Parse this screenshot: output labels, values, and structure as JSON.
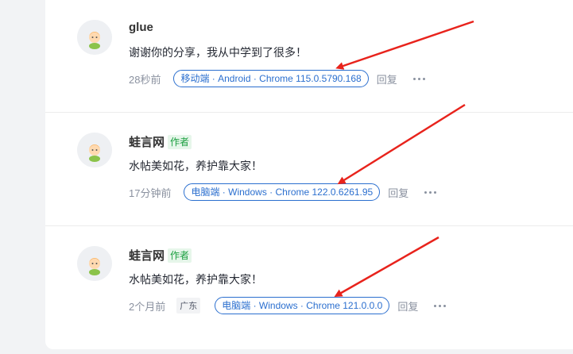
{
  "comments": [
    {
      "username": "glue",
      "author_tag": "",
      "content": "谢谢你的分享，我从中学到了很多！",
      "time": "28秒前",
      "location": "",
      "device": "移动端 · Android · Chrome 115.0.5790.168",
      "reply_label": "回复"
    },
    {
      "username": "蛙言网",
      "author_tag": "作者",
      "content": "水帖美如花，养护靠大家！",
      "time": "17分钟前",
      "location": "",
      "device": "电脑端 · Windows · Chrome 122.0.6261.95",
      "reply_label": "回复"
    },
    {
      "username": "蛙言网",
      "author_tag": "作者",
      "content": "水帖美如花，养护靠大家！",
      "time": "2个月前",
      "location": "广东",
      "device": "电脑端 · Windows · Chrome 121.0.0.0",
      "reply_label": "回复"
    }
  ],
  "colors": {
    "device_badge": "#2b6fcf",
    "author_tag_text": "#1a9e3f",
    "author_tag_bg": "#e6f6ea",
    "annotation_arrow": "#e8231c"
  },
  "icons": {
    "avatar": "cartoon-avatar-icon",
    "more": "more-dots-icon",
    "annotation": "red-arrow-annotation"
  }
}
